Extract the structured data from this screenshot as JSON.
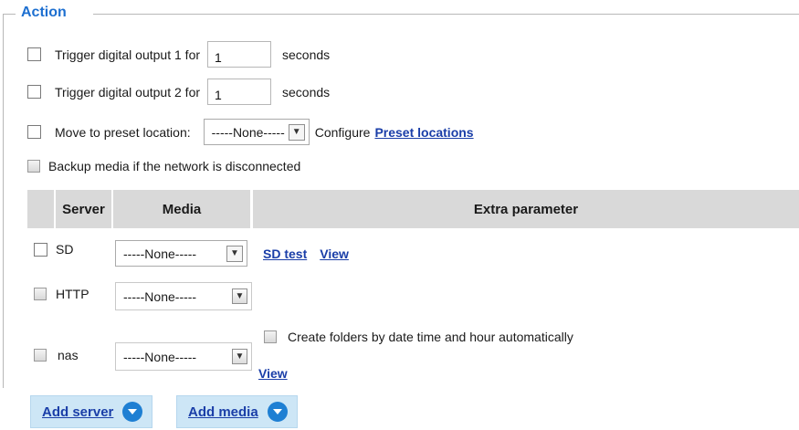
{
  "action": {
    "legend": "Action",
    "trigger_do1": {
      "label": "Trigger digital output 1 for",
      "value": "1",
      "unit": "seconds"
    },
    "trigger_do2": {
      "label": "Trigger digital output 2 for",
      "value": "1",
      "unit": "seconds"
    },
    "preset": {
      "label": "Move to preset location:",
      "selected": "-----None-----",
      "configure_label": "Configure",
      "link_label": "Preset locations"
    },
    "backup_label": "Backup media if the network is disconnected"
  },
  "table": {
    "headers": [
      "Server",
      "Media",
      "Extra parameter"
    ],
    "rows": [
      {
        "server": "SD",
        "media": "-----None-----",
        "test_link": "SD test",
        "view_link": "View"
      },
      {
        "server": "HTTP",
        "media": "-----None-----"
      },
      {
        "server": "nas",
        "media": "-----None-----",
        "folder_label": "Create folders by date time and hour automatically",
        "view_link": "View"
      }
    ]
  },
  "buttons": {
    "add_server": "Add server",
    "add_media": "Add media"
  },
  "colors": {
    "legend": "#1d6fd0",
    "link": "#1a3ea8",
    "header_bg": "#d9d9d9",
    "button_bg": "#cde6f6",
    "button_icon": "#1e7fd3"
  },
  "icons": {
    "select_arrow": "chevron-down-icon",
    "add_icon": "circle-chevron-down-icon"
  }
}
